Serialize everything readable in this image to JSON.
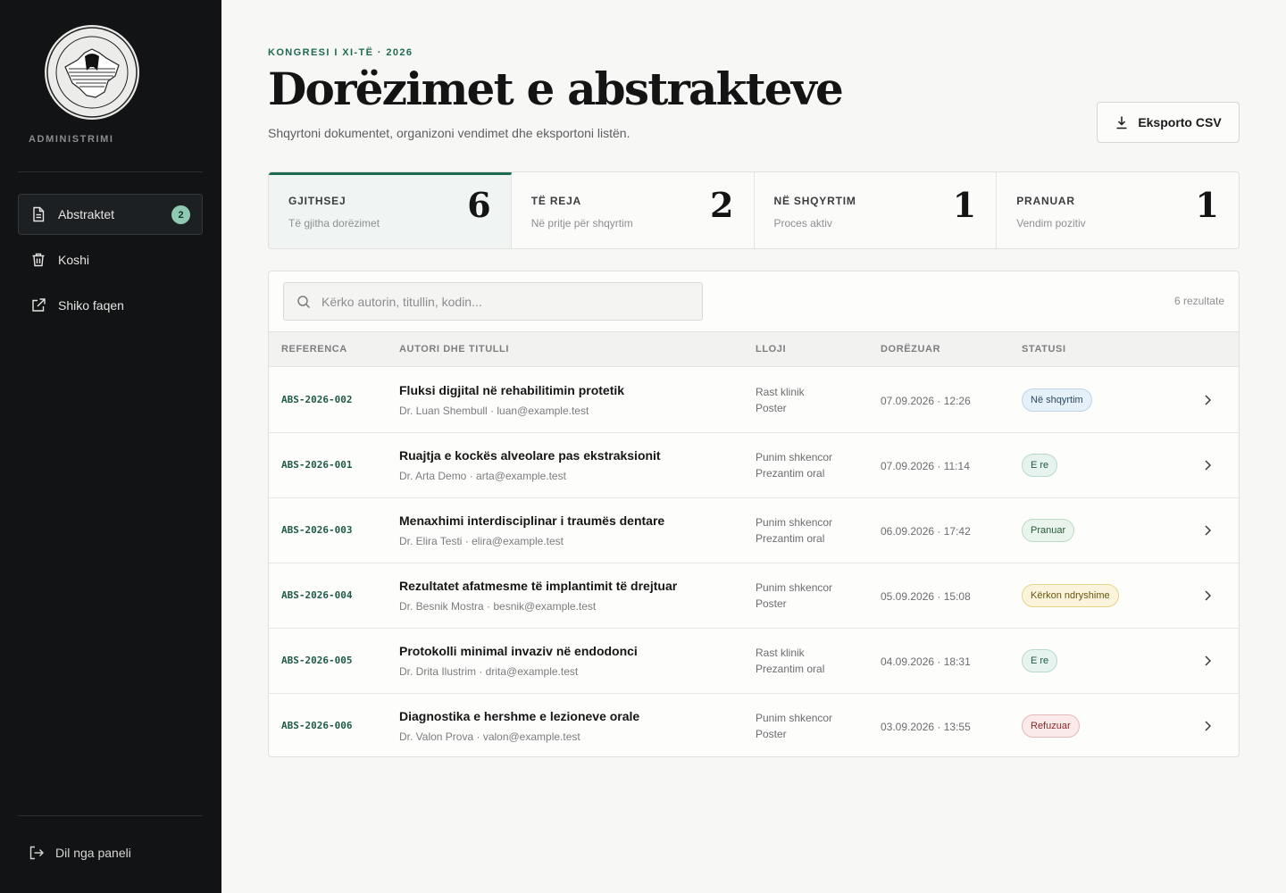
{
  "colors": {
    "sidebar_bg": "#121314",
    "accent": "#1f6a52",
    "badge_review": "#e6f0f8",
    "badge_new": "#e7f3ee",
    "badge_accepted": "#e9f4ec",
    "badge_revise": "#fbf4dc",
    "badge_rejected": "#fbeaea"
  },
  "sidebar": {
    "section_label": "ADMINISTRIMI",
    "items": [
      {
        "label": "Abstraktet",
        "icon": "document-icon",
        "badge": "2",
        "active": true
      },
      {
        "label": "Koshi",
        "icon": "trash-icon"
      },
      {
        "label": "Shiko faqen",
        "icon": "external-link-icon"
      }
    ],
    "logout_label": "Dil nga paneli"
  },
  "header": {
    "eyebrow": "KONGRESI I XI-TË · 2026",
    "title": "Dorëzimet e abstrakteve",
    "subtitle": "Shqyrtoni dokumentet, organizoni vendimet dhe eksportoni listën.",
    "export_label": "Eksporto CSV"
  },
  "stats": [
    {
      "label": "GJITHSEJ",
      "sub": "Të gjitha dorëzimet",
      "value": "6"
    },
    {
      "label": "TË REJA",
      "sub": "Në pritje për shqyrtim",
      "value": "2"
    },
    {
      "label": "NË SHQYRTIM",
      "sub": "Proces aktiv",
      "value": "1"
    },
    {
      "label": "PRANUAR",
      "sub": "Vendim pozitiv",
      "value": "1"
    }
  ],
  "search": {
    "placeholder": "Kërko autorin, titullin, kodin...",
    "results": "6 rezultate"
  },
  "table": {
    "columns": [
      "REFERENCA",
      "AUTORI DHE TITULLI",
      "LLOJI",
      "DORËZUAR",
      "STATUSI"
    ],
    "rows": [
      {
        "ref": "ABS-2026-002",
        "title": "Fluksi digjital në rehabilitimin protetik",
        "author": "Dr. Luan Shembull · luan@example.test",
        "type1": "Rast klinik",
        "type2": "Poster",
        "date": "07.09.2026 · 12:26",
        "status": "Në shqyrtim",
        "status_kind": "review"
      },
      {
        "ref": "ABS-2026-001",
        "title": "Ruajtja e kockës alveolare pas ekstraksionit",
        "author": "Dr. Arta Demo · arta@example.test",
        "type1": "Punim shkencor",
        "type2": "Prezantim oral",
        "date": "07.09.2026 · 11:14",
        "status": "E re",
        "status_kind": "new"
      },
      {
        "ref": "ABS-2026-003",
        "title": "Menaxhimi interdisciplinar i traumës dentare",
        "author": "Dr. Elira Testi · elira@example.test",
        "type1": "Punim shkencor",
        "type2": "Prezantim oral",
        "date": "06.09.2026 · 17:42",
        "status": "Pranuar",
        "status_kind": "accepted"
      },
      {
        "ref": "ABS-2026-004",
        "title": "Rezultatet afatmesme të implantimit të drejtuar",
        "author": "Dr. Besnik Mostra · besnik@example.test",
        "type1": "Punim shkencor",
        "type2": "Poster",
        "date": "05.09.2026 · 15:08",
        "status": "Kërkon ndryshime",
        "status_kind": "revise"
      },
      {
        "ref": "ABS-2026-005",
        "title": "Protokolli minimal invaziv në endodonci",
        "author": "Dr. Drita Ilustrim · drita@example.test",
        "type1": "Rast klinik",
        "type2": "Prezantim oral",
        "date": "04.09.2026 · 18:31",
        "status": "E re",
        "status_kind": "new"
      },
      {
        "ref": "ABS-2026-006",
        "title": "Diagnostika e hershme e lezioneve orale",
        "author": "Dr. Valon Prova · valon@example.test",
        "type1": "Punim shkencor",
        "type2": "Poster",
        "date": "03.09.2026 · 13:55",
        "status": "Refuzuar",
        "status_kind": "rejected"
      }
    ]
  }
}
